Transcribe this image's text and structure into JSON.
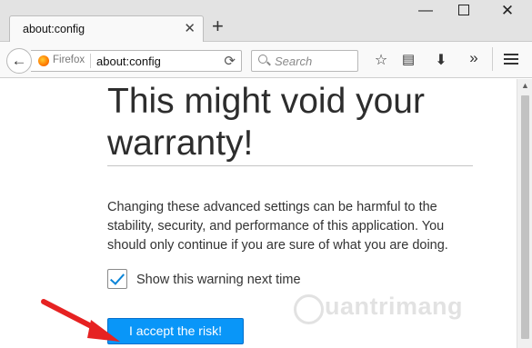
{
  "tab": {
    "title": "about:config"
  },
  "window": {
    "minimize": "—",
    "close": "✕"
  },
  "navbar": {
    "identity_label": "Firefox",
    "url": "about:config",
    "search_placeholder": "Search"
  },
  "warning": {
    "title": "This might void your warranty!",
    "body": "Changing these advanced settings can be harmful to the stability, security, and performance of this application. You should only continue if you are sure of what you are doing.",
    "checkbox_label": "Show this warning next time",
    "checkbox_checked": true,
    "accept_label": "I accept the risk!"
  },
  "watermark": {
    "text": "uantrimang"
  },
  "colors": {
    "accent": "#0996f8",
    "arrow": "#e62222"
  },
  "icons": {
    "back": "back-arrow-icon",
    "reload": "reload-icon",
    "search": "search-icon",
    "star": "star-icon",
    "reading_list": "reading-list-icon",
    "download": "download-icon",
    "overflow": "chevron-double-right-icon",
    "menu": "hamburger-menu-icon"
  }
}
